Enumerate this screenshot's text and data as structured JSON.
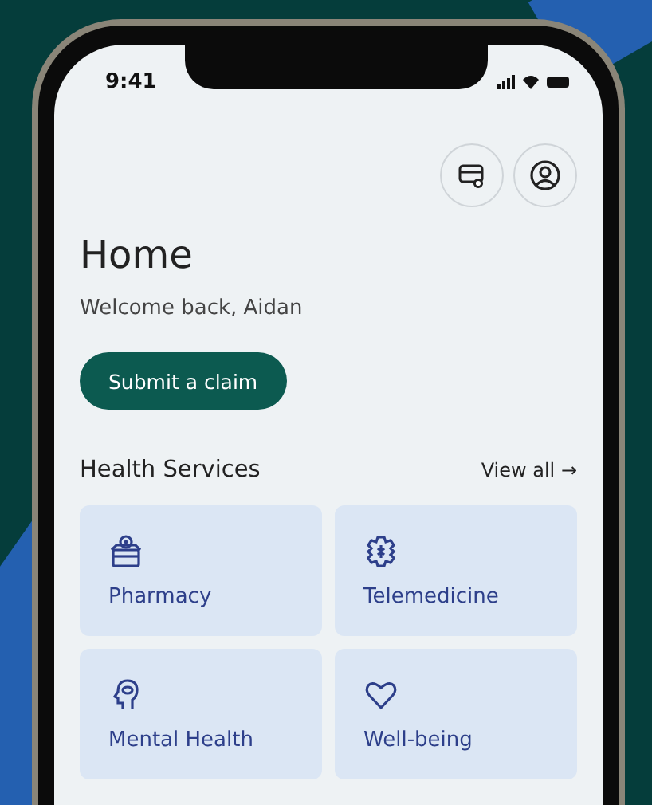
{
  "status_bar": {
    "time": "9:41"
  },
  "header": {
    "title": "Home",
    "greeting": "Welcome back, Aidan",
    "action": "Submit a claim"
  },
  "health_services": {
    "title": "Health Services",
    "link": "View all →",
    "items": [
      {
        "label": "Pharmacy"
      },
      {
        "label": "Telemedicine"
      },
      {
        "label": "Mental Health"
      },
      {
        "label": "Well-being"
      }
    ]
  }
}
